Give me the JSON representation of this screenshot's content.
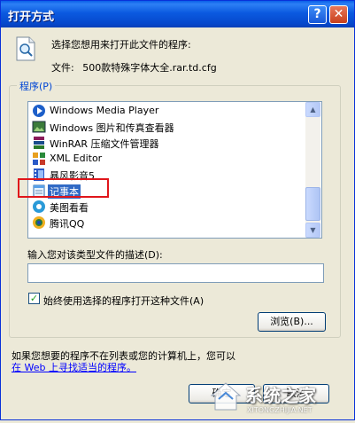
{
  "window": {
    "title": "打开方式",
    "help_glyph": "?",
    "close_glyph": "✕"
  },
  "header": {
    "prompt": "选择您想用来打开此文件的程序:",
    "file_label": "文件:",
    "file_name": "500款特殊字体大全.rar.td.cfg"
  },
  "programs": {
    "legend": "程序(P)",
    "items": [
      {
        "label": "Windows Media Player",
        "icon": "media-player-icon",
        "selected": false
      },
      {
        "label": "Windows 图片和传真查看器",
        "icon": "photo-viewer-icon",
        "selected": false
      },
      {
        "label": "WinRAR 压缩文件管理器",
        "icon": "winrar-icon",
        "selected": false
      },
      {
        "label": "XML Editor",
        "icon": "xml-editor-icon",
        "selected": false
      },
      {
        "label": "暴风影音5",
        "icon": "storm-player-icon",
        "selected": false
      },
      {
        "label": "记事本",
        "icon": "notepad-icon",
        "selected": true
      },
      {
        "label": "美图看看",
        "icon": "meitu-icon",
        "selected": false
      },
      {
        "label": "腾讯QQ",
        "icon": "qq-icon",
        "selected": false
      }
    ],
    "scroll_up": "▲",
    "scroll_down": "▼"
  },
  "description": {
    "label": "输入您对该类型文件的描述(D):",
    "value": ""
  },
  "always_use": {
    "label": "始终使用选择的程序打开这种文件(A)",
    "checked": true,
    "check_glyph": "✓"
  },
  "buttons": {
    "browse": "浏览(B)...",
    "ok": "确定",
    "cancel": "取消"
  },
  "footer": {
    "note": "如果您想要的程序不在列表或您的计算机上，您可以",
    "link": "在 Web 上寻找适当的程序。"
  },
  "watermark": {
    "text": "系统之家",
    "subtext": "XITONGZHIJIA.NET"
  },
  "colors": {
    "titlebar": "#0a5fe8",
    "selection": "#316ac5",
    "highlight_box": "#e0161b",
    "link": "#0000ff",
    "legend": "#0046d5"
  }
}
